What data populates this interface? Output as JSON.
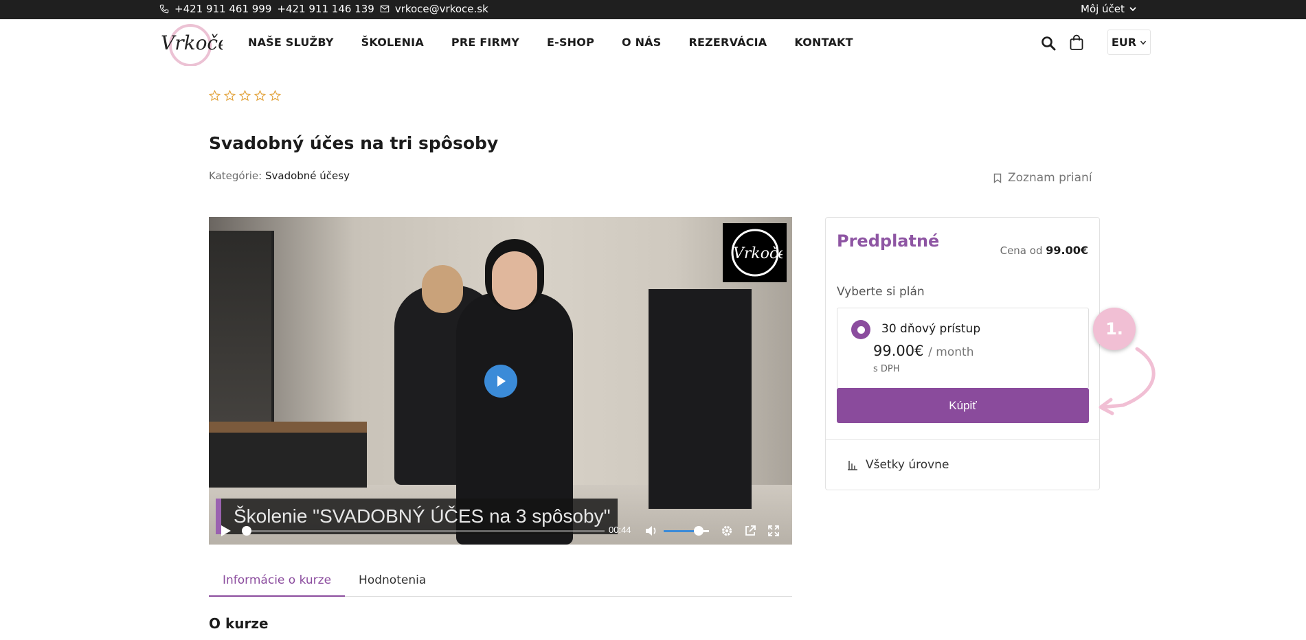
{
  "topbar": {
    "phone1": "+421 911 461 999",
    "phone2": "+421 911 146 139",
    "email": "vrkoce@vrkoce.sk",
    "account_label": "Môj účet"
  },
  "header": {
    "logo_text": "Vrkoče",
    "nav": [
      "NAŠE SLUŽBY",
      "ŠKOLENIA",
      "PRE FIRMY",
      "E-SHOP",
      "O NÁS",
      "REZERVÁCIA",
      "KONTAKT"
    ],
    "currency": "EUR"
  },
  "product": {
    "rating_stars": 5,
    "rating_value": 0,
    "title": "Svadobný účes na tri spôsoby",
    "category_label": "Kategórie:",
    "category_value": "Svadobné účesy",
    "wishlist_label": "Zoznam prianí"
  },
  "video": {
    "watermark_text": "Vrkoče",
    "subtitle": "Školenie \"SVADOBNÝ ÚČES na 3 spôsoby\"",
    "time": "00:44",
    "progress": 0,
    "volume": 0.77
  },
  "tabs": [
    {
      "label": "Informácie o kurze",
      "active": true
    },
    {
      "label": "Hodnotenia",
      "active": false
    }
  ],
  "section_title": "O kurze",
  "card": {
    "title": "Predplatné",
    "price_from_label": "Cena od",
    "price_from_value": "99.00€",
    "plan_prompt": "Vyberte si plán",
    "plan": {
      "name": "30 dňový prístup",
      "price": "99.00€",
      "period": "/ month",
      "tax_note": "s DPH",
      "selected": true
    },
    "buy_label": "Kúpiť",
    "levels_label": "Všetky úrovne"
  },
  "annotation": {
    "label": "1."
  },
  "colors": {
    "accent": "#8a4b9c",
    "topbar": "#1f1f1f",
    "video_play": "#3b8bd8",
    "annotation": "#f1bfd4",
    "star": "#e2a23a"
  }
}
